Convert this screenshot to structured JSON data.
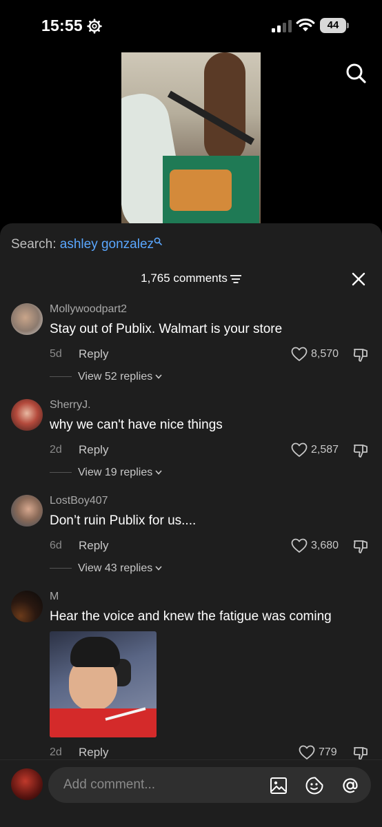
{
  "status_bar": {
    "time": "15:55",
    "battery": "44"
  },
  "search": {
    "prefix": "Search:",
    "term": "ashley gonzalez"
  },
  "comments_header": {
    "count_label": "1,765 comments"
  },
  "comments": [
    {
      "user": "Mollywoodpart2",
      "text": "Stay out of Publix. Walmart is your store",
      "age": "5d",
      "reply": "Reply",
      "likes": "8,570",
      "view_replies": "View 52 replies"
    },
    {
      "user": "SherryJ.",
      "text": "why we can't have nice things",
      "age": "2d",
      "reply": "Reply",
      "likes": "2,587",
      "view_replies": "View 19 replies"
    },
    {
      "user": "LostBoy407",
      "text": "Don’t ruin Publix for us....",
      "age": "6d",
      "reply": "Reply",
      "likes": "3,680",
      "view_replies": "View 43 replies"
    },
    {
      "user": "M",
      "text": "Hear the voice and knew the fatigue was coming",
      "age": "2d",
      "reply": "Reply",
      "likes": "779"
    }
  ],
  "composer": {
    "placeholder": "Add comment..."
  },
  "colors": {
    "accent_link": "#5aa7ff",
    "panel_bg": "#1e1e1e"
  }
}
